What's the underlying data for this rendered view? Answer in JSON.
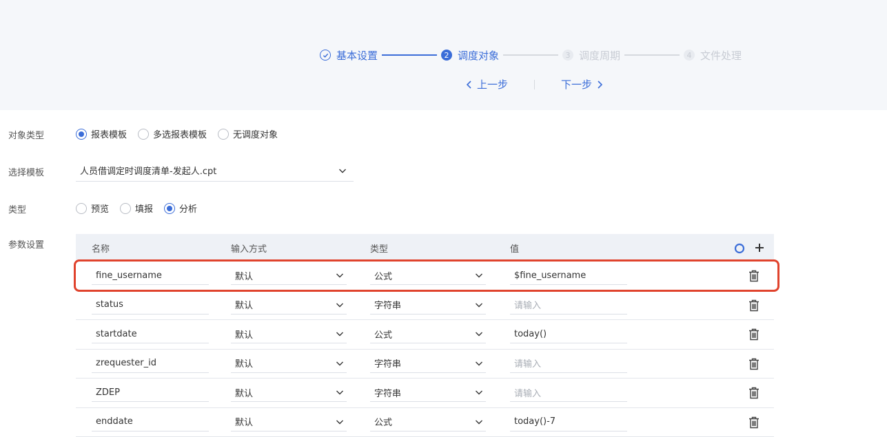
{
  "steps": [
    {
      "num": "",
      "label": "基本设置",
      "state": "done"
    },
    {
      "num": "2",
      "label": "调度对象",
      "state": "active"
    },
    {
      "num": "3",
      "label": "调度周期",
      "state": "todo"
    },
    {
      "num": "4",
      "label": "文件处理",
      "state": "todo"
    }
  ],
  "nav": {
    "prev": "上一步",
    "next": "下一步"
  },
  "form": {
    "object_type": {
      "label": "对象类型",
      "options": [
        "报表模板",
        "多选报表模板",
        "无调度对象"
      ],
      "selected": 0
    },
    "template": {
      "label": "选择模板",
      "value": "人员借调定时调度清单-发起人.cpt"
    },
    "type": {
      "label": "类型",
      "options": [
        "预览",
        "填报",
        "分析"
      ],
      "selected": 2
    },
    "params": {
      "label": "参数设置"
    }
  },
  "table": {
    "headers": [
      "名称",
      "输入方式",
      "类型",
      "值"
    ],
    "placeholder": "请输入",
    "rows": [
      {
        "name": "fine_username",
        "mode": "默认",
        "type": "公式",
        "value": "$fine_username"
      },
      {
        "name": "status",
        "mode": "默认",
        "type": "字符串",
        "value": ""
      },
      {
        "name": "startdate",
        "mode": "默认",
        "type": "公式",
        "value": "today()"
      },
      {
        "name": "zrequester_id",
        "mode": "默认",
        "type": "字符串",
        "value": ""
      },
      {
        "name": "ZDEP",
        "mode": "默认",
        "type": "字符串",
        "value": ""
      },
      {
        "name": "enddate",
        "mode": "默认",
        "type": "公式",
        "value": "today()-7"
      }
    ]
  },
  "colors": {
    "accent": "#3b6dd8",
    "highlight": "#e0432d"
  }
}
